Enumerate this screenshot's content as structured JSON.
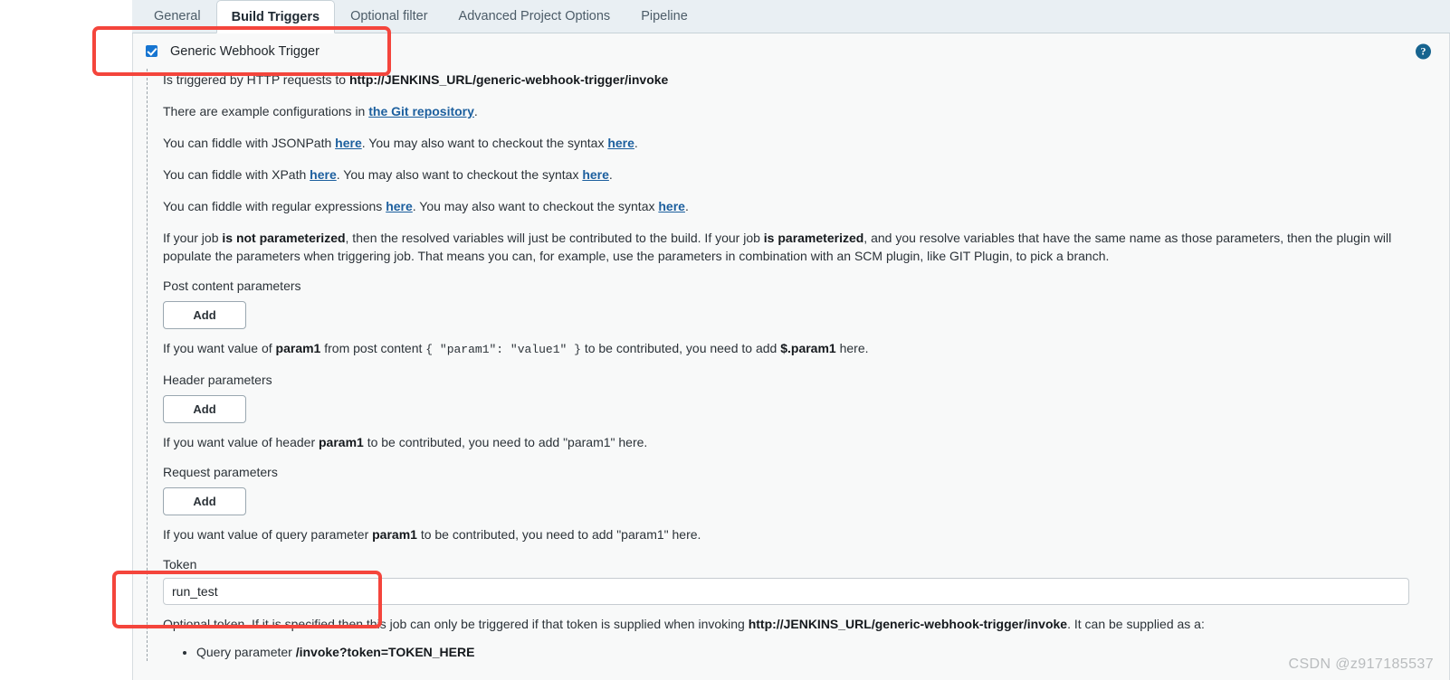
{
  "tabs": [
    {
      "label": "General",
      "active": false
    },
    {
      "label": "Build Triggers",
      "active": true
    },
    {
      "label": "Optional filter",
      "active": false
    },
    {
      "label": "Advanced Project Options",
      "active": false
    },
    {
      "label": "Pipeline",
      "active": false
    }
  ],
  "trigger": {
    "checkbox_label": "Generic Webhook Trigger",
    "checked": true,
    "help_icon": "help-icon",
    "help_glyph": "?"
  },
  "intro": {
    "line1_prefix": "Is triggered by HTTP requests to ",
    "line1_url": "http://JENKINS_URL/generic-webhook-trigger/invoke",
    "line2_prefix": "There are example configurations in ",
    "line2_link": "the Git repository",
    "line2_suffix": ".",
    "jsonpath_prefix": "You can fiddle with JSONPath ",
    "jsonpath_link1": "here",
    "jsonpath_mid": ". You may also want to checkout the syntax ",
    "jsonpath_link2": "here",
    "jsonpath_suffix": ".",
    "xpath_prefix": "You can fiddle with XPath ",
    "xpath_link1": "here",
    "xpath_mid": ". You may also want to checkout the syntax ",
    "xpath_link2": "here",
    "xpath_suffix": ".",
    "regex_prefix": "You can fiddle with regular expressions ",
    "regex_link1": "here",
    "regex_mid": ". You may also want to checkout the syntax ",
    "regex_link2": "here",
    "regex_suffix": "."
  },
  "parameterized": {
    "p1": "If your job ",
    "b1": "is not parameterized",
    "p2": ", then the resolved variables will just be contributed to the build. If your job ",
    "b2": "is parameterized",
    "p3": ", and you resolve variables that have the same name as those parameters, then the plugin will populate the parameters when triggering job. That means you can, for example, use the parameters in combination with an SCM plugin, like GIT Plugin, to pick a branch."
  },
  "post_content": {
    "title": "Post content parameters",
    "add_label": "Add",
    "note_p1": "If you want value of ",
    "note_b1": "param1",
    "note_p2": " from post content ",
    "note_code": "{ \"param1\": \"value1\" }",
    "note_p3": " to be contributed, you need to add ",
    "note_b2": "$.param1",
    "note_p4": " here."
  },
  "header_params": {
    "title": "Header parameters",
    "add_label": "Add",
    "note_p1": "If you want value of header ",
    "note_b1": "param1",
    "note_p2": " to be contributed, you need to add \"param1\" here."
  },
  "request_params": {
    "title": "Request parameters",
    "add_label": "Add",
    "note_p1": "If you want value of query parameter ",
    "note_b1": "param1",
    "note_p2": " to be contributed, you need to add \"param1\" here."
  },
  "token": {
    "label": "Token",
    "value": "run_test",
    "placeholder": "",
    "note_p1": "Optional token. If it is specified then this job can only be triggered if that token is supplied when invoking ",
    "note_b1": "http://JENKINS_URL/generic-webhook-trigger/invoke",
    "note_p2": ". It can be supplied as a:",
    "bullet1_p1": "Query parameter ",
    "bullet1_b1": "/invoke?token=TOKEN_HERE"
  },
  "annotations": {
    "box_color": "#f4453c",
    "boxes": [
      "checkbox-highlight",
      "token-highlight"
    ]
  },
  "watermark": "CSDN @z917185537"
}
